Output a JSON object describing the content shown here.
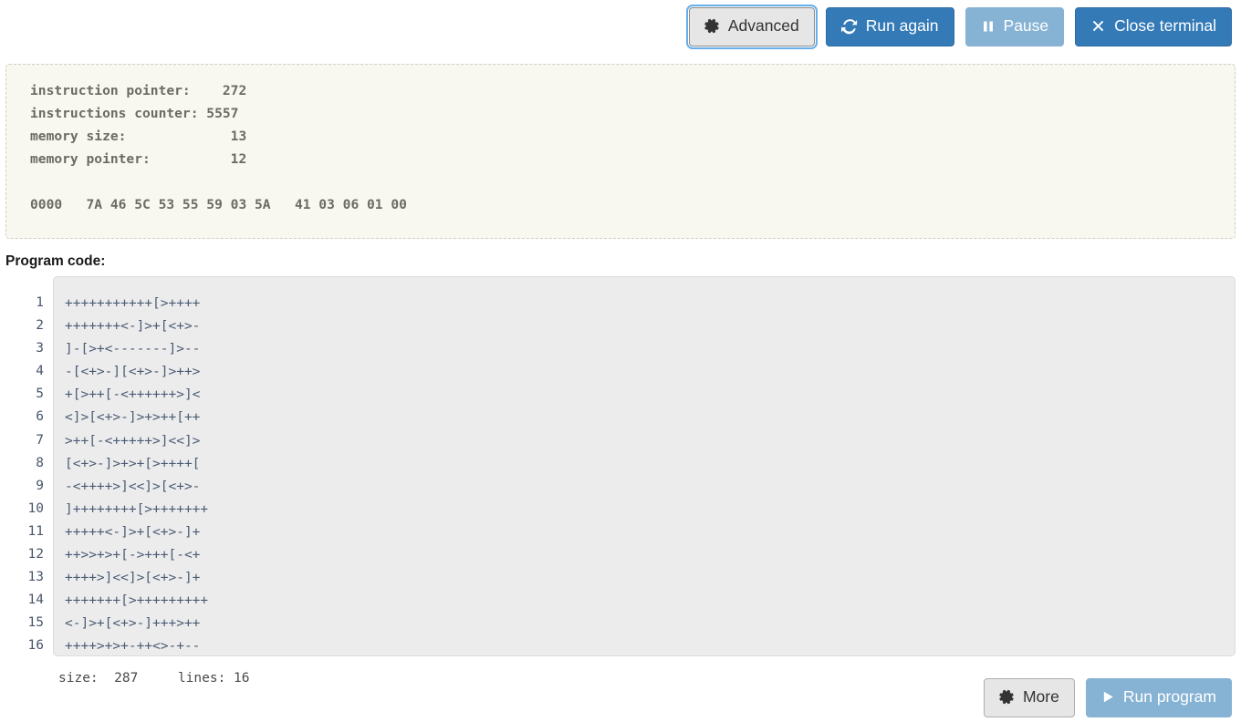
{
  "toolbar": {
    "buttons": [
      {
        "label": "Advanced",
        "icon": "gear-icon",
        "style": "default",
        "focused": true
      },
      {
        "label": "Run again",
        "icon": "refresh-icon",
        "style": "primary",
        "focused": false
      },
      {
        "label": "Pause",
        "icon": "pause-icon",
        "style": "muted",
        "focused": false
      },
      {
        "label": "Close terminal",
        "icon": "close-x-icon",
        "style": "primary",
        "focused": false
      }
    ]
  },
  "terminal": {
    "text": "instruction pointer:    272\ninstructions counter: 5557\nmemory size:             13\nmemory pointer:          12\n\n0000   7A 46 5C 53 55 59 03 5A   41 03 06 01 00",
    "fields": [
      {
        "label": "instruction pointer:",
        "value": "272"
      },
      {
        "label": "instructions counter:",
        "value": "5557"
      },
      {
        "label": "memory size:",
        "value": "13"
      },
      {
        "label": "memory pointer:",
        "value": "12"
      }
    ],
    "memory_dump": {
      "offset": "0000",
      "bytes": [
        "7A",
        "46",
        "5C",
        "53",
        "55",
        "59",
        "03",
        "5A",
        "41",
        "03",
        "06",
        "01",
        "00"
      ]
    }
  },
  "code_section": {
    "label": "Program code:",
    "line_numbers": [
      "1",
      "2",
      "3",
      "4",
      "5",
      "6",
      "7",
      "8",
      "9",
      "10",
      "11",
      "12",
      "13",
      "14",
      "15",
      "16"
    ],
    "lines": [
      "+++++++++++[>++++",
      "+++++++<-]>+[<+>-",
      "]-[>+<-------]>--",
      "-[<+>-][<+>-]>++>",
      "+[>++[-<++++++>]<",
      "<]>[<+>-]>+>++[++",
      ">++[-<+++++>]<<]>",
      "[<+>-]>+>+[>++++[",
      "-<++++>]<<]>[<+>-",
      "]++++++++[>+++++++",
      "+++++<-]>+[<+>-]+",
      "++>>+>+[->+++[-<+",
      "++++>]<<]>[<+>-]+",
      "+++++++[>+++++++++",
      "<-]>+[<+>-]+++>++",
      "++++>+>+-++<>-+--"
    ],
    "status": "size:  287     lines: 16",
    "status_parts": {
      "size_label": "size:",
      "size_value": "287",
      "lines_label": "lines:",
      "lines_value": "16"
    }
  },
  "bottom_actions": {
    "buttons": [
      {
        "label": "More",
        "icon": "gear-icon",
        "style": "default"
      },
      {
        "label": "Run program",
        "icon": "play-icon",
        "style": "muted"
      }
    ]
  },
  "colors": {
    "primary": "#337ab7",
    "muted": "#86b2d4",
    "default": "#e6e6e6",
    "terminal_bg": "#f8f8f0",
    "code_bg": "#ececec",
    "code_text": "#4a5a74"
  }
}
